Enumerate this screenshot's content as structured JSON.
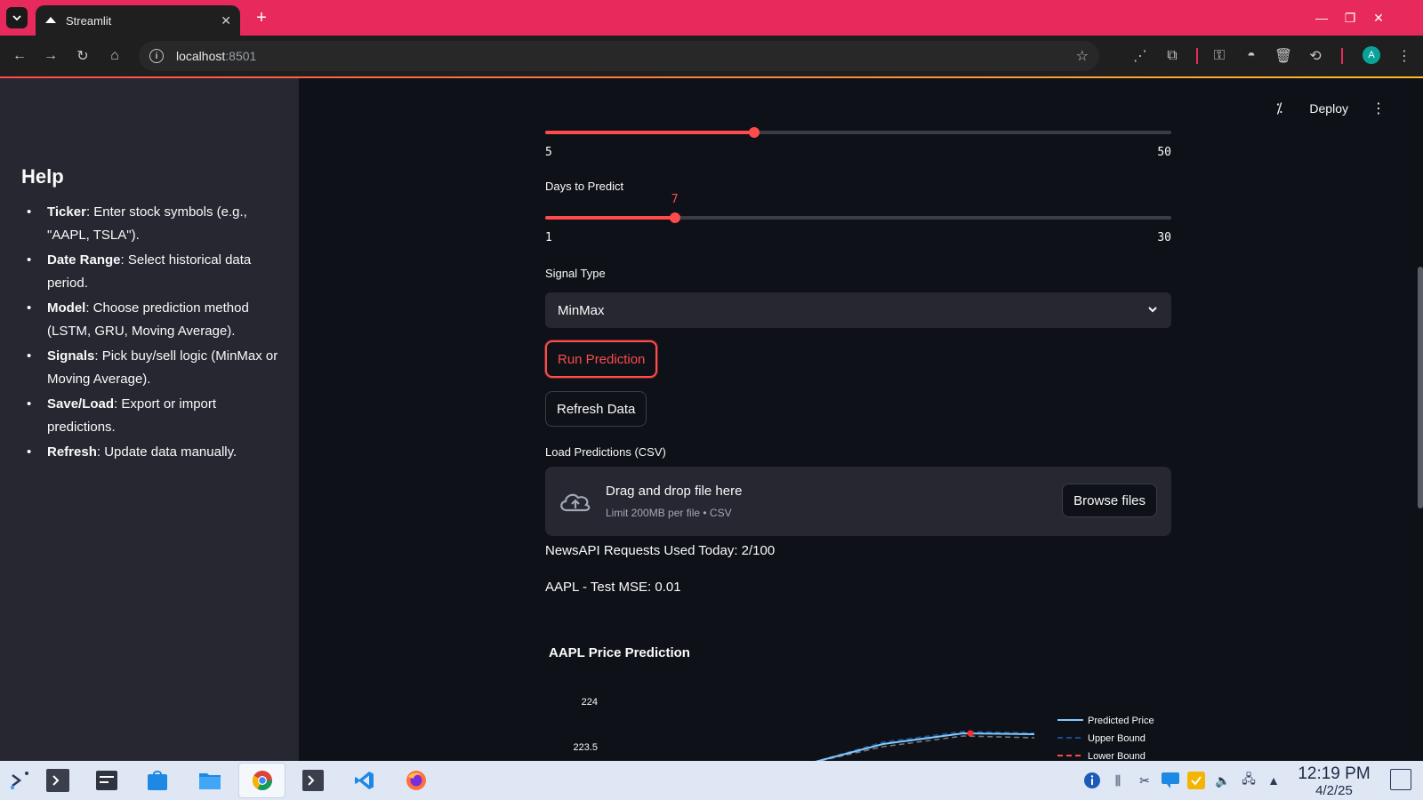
{
  "browser": {
    "tab_title": "Streamlit",
    "url_host": "localhost",
    "url_port": ":8501",
    "profile_initial": "A"
  },
  "header": {
    "deploy_label": "Deploy"
  },
  "sidebar": {
    "title": "Help",
    "items": [
      {
        "term": "Ticker",
        "text": ": Enter stock symbols (e.g., \"AAPL, TSLA\")."
      },
      {
        "term": "Date Range",
        "text": ": Select historical data period."
      },
      {
        "term": "Model",
        "text": ": Choose prediction method (LSTM, GRU, Moving Average)."
      },
      {
        "term": "Signals",
        "text": ": Pick buy/sell logic (MinMax or Moving Average)."
      },
      {
        "term": "Save/Load",
        "text": ": Export or import predictions."
      },
      {
        "term": "Refresh",
        "text": ": Update data manually."
      }
    ]
  },
  "main": {
    "slider1": {
      "min": "5",
      "max": "50",
      "value": 20
    },
    "slider2": {
      "label": "Days to Predict",
      "min": "1",
      "max": "30",
      "value": "7"
    },
    "signal": {
      "label": "Signal Type",
      "selected": "MinMax"
    },
    "run_button": "Run Prediction",
    "refresh_button": "Refresh Data",
    "uploader": {
      "label": "Load Predictions (CSV)",
      "drag_text": "Drag and drop file here",
      "limit_text": "Limit 200MB per file • CSV",
      "browse_label": "Browse files"
    },
    "news_text": "NewsAPI Requests Used Today: 2/100",
    "mse_text": "AAPL - Test MSE: 0.01"
  },
  "chart_data": {
    "type": "line",
    "title": "AAPL Price Prediction",
    "y_ticks": [
      "224",
      "223.5"
    ],
    "series": [
      {
        "name": "Predicted Price",
        "color": "#83c9ff",
        "style": "solid"
      },
      {
        "name": "Upper Bound",
        "color": "#1a4d8c",
        "style": "dashed"
      },
      {
        "name": "Lower Bound",
        "color": "#ff4b4b",
        "style": "dashed"
      }
    ]
  },
  "taskbar": {
    "time": "12:19 PM",
    "date": "4/2/25"
  },
  "colors": {
    "accent": "#ff4b4b",
    "tabbar": "#e8295c",
    "sidebar_bg": "#262730",
    "main_bg": "#0e1117"
  }
}
